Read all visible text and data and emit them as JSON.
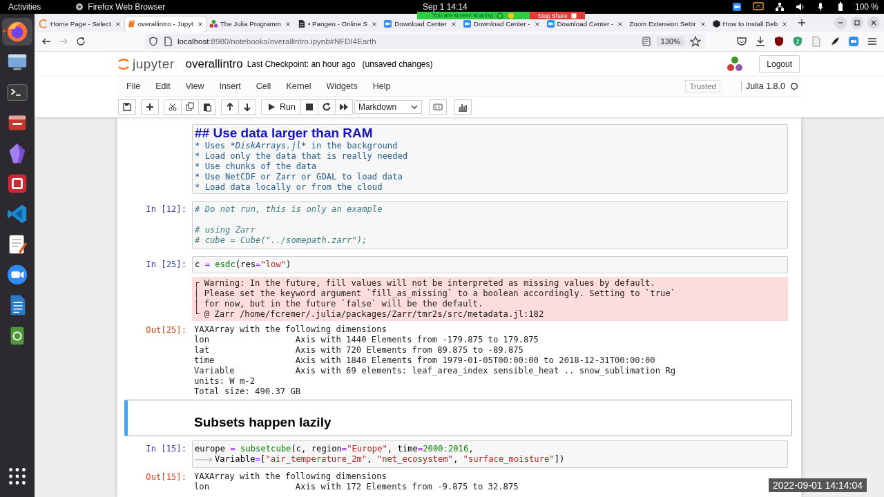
{
  "top_bar": {
    "activities": "Activities",
    "app": "Firefox Web Browser",
    "clock": "Sep 1  14:14",
    "battery": "100 %"
  },
  "dock": [
    {
      "kind": "firefox",
      "selected": true
    },
    {
      "kind": "display",
      "selected": false
    },
    {
      "kind": "terminal",
      "selected": false
    },
    {
      "kind": "files",
      "selected": false
    },
    {
      "kind": "crystal",
      "selected": false
    },
    {
      "kind": "reference",
      "selected": false
    },
    {
      "kind": "vscode",
      "selected": false
    },
    {
      "kind": "editor",
      "selected": false
    },
    {
      "kind": "zoom",
      "selected": false
    },
    {
      "kind": "writer",
      "selected": false
    },
    {
      "kind": "trash",
      "selected": false
    },
    {
      "kind": "apps",
      "selected": false
    }
  ],
  "tabs": [
    {
      "title": "Home Page - Select",
      "kind": "spinner",
      "selected": false
    },
    {
      "title": "overallintro - Jupyt",
      "kind": "jupyter",
      "selected": true
    },
    {
      "title": "The Julia Programm",
      "kind": "julia",
      "selected": false
    },
    {
      "title": "• Pangeo - Online S",
      "kind": "document",
      "selected": false
    },
    {
      "title": "Download Center",
      "kind": "zoom",
      "selected": false
    },
    {
      "title": "Download Center -",
      "kind": "zoom",
      "selected": false
    },
    {
      "title": "Download Center -",
      "kind": "zoom",
      "selected": false
    },
    {
      "title": "Zoom Extension Settir",
      "kind": "plain",
      "selected": false
    },
    {
      "title": "How to Install Deb",
      "kind": "hexagon",
      "selected": false
    }
  ],
  "screen_share": {
    "status": "You are screen sharing",
    "stop": "Stop Share"
  },
  "address": {
    "host": "localhost",
    "path": ":8980/notebooks/overallintro.ipynb#NFDI4Earth",
    "zoom": "130%"
  },
  "jupyter": {
    "logo": "jupyter",
    "notebook": "overallintro",
    "checkpoint": "Last Checkpoint: an hour ago",
    "unsaved": "(unsaved changes)",
    "logout": "Logout"
  },
  "menu": [
    "File",
    "Edit",
    "View",
    "Insert",
    "Cell",
    "Kernel",
    "Widgets",
    "Help"
  ],
  "trusted": "Trusted",
  "kernel": "Julia 1.8.0",
  "toolbar": {
    "run": "Run",
    "cell_type": "Markdown"
  },
  "cells": [
    {
      "kind": "markdown_source",
      "selected": false,
      "lines": [
        {
          "tokens": [
            {
              "text": "## Use data larger than RAM",
              "kind": "md_heading"
            }
          ]
        },
        {
          "tokens": [
            {
              "text": "* Uses ",
              "kind": "md_text"
            },
            {
              "text": "*DiskArrays.jl*",
              "kind": "md_emphasis"
            },
            {
              "text": " in the background",
              "kind": "md_text"
            }
          ]
        },
        {
          "tokens": [
            {
              "text": "* Load only the data that is really needed",
              "kind": "md_text"
            }
          ]
        },
        {
          "tokens": [
            {
              "text": "* Use chunks of the data",
              "kind": "md_text"
            }
          ]
        },
        {
          "tokens": [
            {
              "text": "* Use NetCDF or Zarr or GDAL to load data",
              "kind": "md_text"
            }
          ]
        },
        {
          "tokens": [
            {
              "text": "* Load data locally or from the cloud",
              "kind": "md_text"
            }
          ]
        }
      ]
    },
    {
      "kind": "code",
      "selected": false,
      "prompt": "In [12]:",
      "lines": [
        {
          "tokens": [
            {
              "text": "# Do not run, this is only an example",
              "kind": "comment"
            }
          ]
        },
        {
          "blank_before": true,
          "tokens": [
            {
              "text": "# using Zarr",
              "kind": "comment"
            }
          ]
        },
        {
          "tokens": [
            {
              "text": "# cube = Cube(\"../somepath.zarr\");",
              "kind": "comment"
            }
          ]
        }
      ]
    },
    {
      "kind": "code",
      "selected": false,
      "prompt": "In [25]:",
      "lines": [
        {
          "tokens": [
            {
              "text": "c ",
              "kind": "plain"
            },
            {
              "text": "=",
              "kind": "operator"
            },
            {
              "text": " esdc",
              "kind": "function"
            },
            {
              "text": "(res",
              "kind": "plain"
            },
            {
              "text": "=",
              "kind": "operator"
            },
            {
              "text": "\"low\"",
              "kind": "string"
            },
            {
              "text": ")",
              "kind": "plain"
            }
          ]
        }
      ],
      "outputs": [
        {
          "kind": "stderr",
          "lines": [
            "┌ Warning: In the future, fill values will not be interpreted as missing values by default.",
            "│ Please set the keyword argument `fill_as_missing` to a boolean accordingly. Setting to `true`",
            "│ for now, but in the future `false` will be the default.",
            "└ @ Zarr /home/fcremer/.julia/packages/Zarr/tmr2s/src/metadata.jl:182"
          ]
        },
        {
          "kind": "result",
          "prompt": "Out[25]:",
          "lines": [
            "YAXArray with the following dimensions",
            "lon                 Axis with 1440 Elements from -179.875 to 179.875",
            "lat                 Axis with 720 Elements from 89.875 to -89.875",
            "time                Axis with 1840 Elements from 1979-01-05T00:00:00 to 2018-12-31T00:00:00",
            "Variable            Axis with 69 elements: leaf_area_index sensible_heat .. snow_sublimation Rg",
            "units: W m-2",
            "Total size: 490.37 GB"
          ]
        }
      ]
    },
    {
      "kind": "markdown_rendered",
      "selected": true,
      "heading": "Subsets happen lazily"
    },
    {
      "kind": "code",
      "selected": false,
      "prompt": "In [15]:",
      "lines": [
        {
          "tokens": [
            {
              "text": "europe ",
              "kind": "plain"
            },
            {
              "text": "=",
              "kind": "operator"
            },
            {
              "text": " subsetcube",
              "kind": "function"
            },
            {
              "text": "(c, region",
              "kind": "plain"
            },
            {
              "text": "=",
              "kind": "operator"
            },
            {
              "text": "\"Europe\"",
              "kind": "string"
            },
            {
              "text": ", time",
              "kind": "plain"
            },
            {
              "text": "=",
              "kind": "operator"
            },
            {
              "text": "2000",
              "kind": "number"
            },
            {
              "text": ":",
              "kind": "operator"
            },
            {
              "text": "2016",
              "kind": "number"
            },
            {
              "text": ",",
              "kind": "plain"
            }
          ]
        },
        {
          "continuation": true,
          "tokens": [
            {
              "text": "Variable",
              "kind": "plain"
            },
            {
              "text": "=",
              "kind": "operator"
            },
            {
              "text": "[",
              "kind": "plain"
            },
            {
              "text": "\"air_temperature_2m\"",
              "kind": "string"
            },
            {
              "text": ", ",
              "kind": "plain"
            },
            {
              "text": "\"net_ecosystem\"",
              "kind": "string"
            },
            {
              "text": ", ",
              "kind": "plain"
            },
            {
              "text": "\"surface_moisture\"",
              "kind": "string"
            },
            {
              "text": "])",
              "kind": "plain"
            }
          ]
        }
      ],
      "outputs": [
        {
          "kind": "result",
          "prompt": "Out[15]:",
          "lines": [
            "YAXArray with the following dimensions",
            "lon                 Axis with 172 Elements from -9.875 to 32.875"
          ]
        }
      ]
    }
  ],
  "timestamp": "2022-09-01 14:14:04"
}
